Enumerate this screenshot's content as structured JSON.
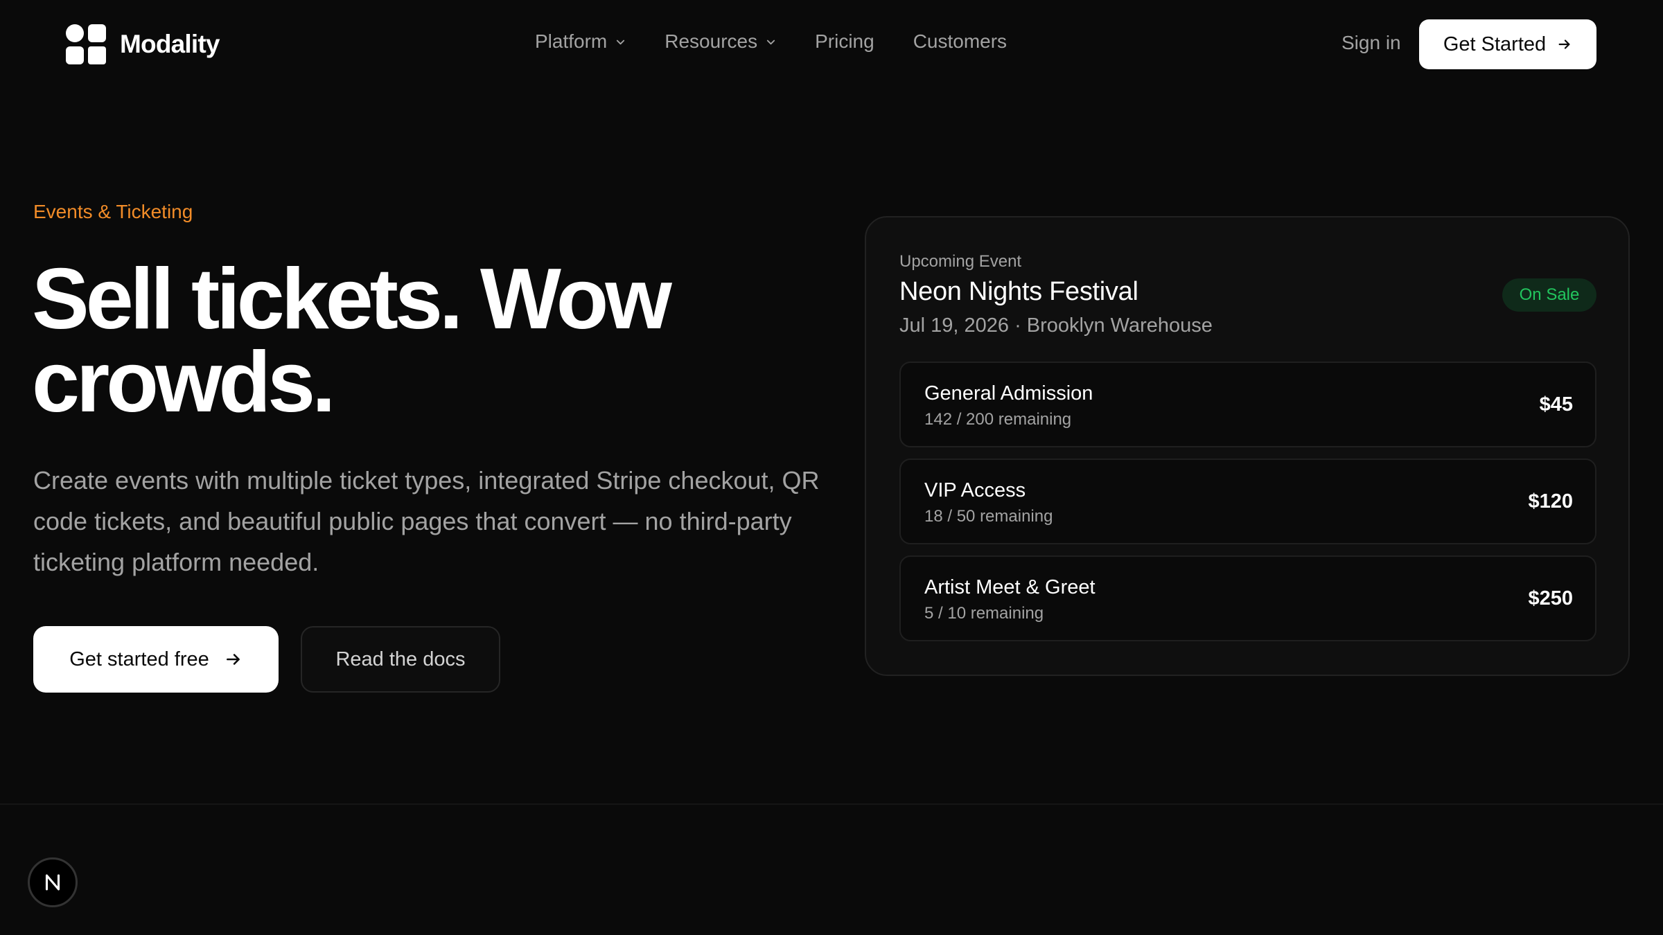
{
  "nav": {
    "brand": "Modality",
    "links": [
      {
        "label": "Platform",
        "has_dropdown": true
      },
      {
        "label": "Resources",
        "has_dropdown": true
      },
      {
        "label": "Pricing",
        "has_dropdown": false
      },
      {
        "label": "Customers",
        "has_dropdown": false
      }
    ],
    "sign_in": "Sign in",
    "cta": "Get Started"
  },
  "hero": {
    "eyebrow": "Events & Ticketing",
    "headline": "Sell tickets. Wow crowds.",
    "description": "Create events with multiple ticket types, integrated Stripe checkout, QR code tickets, and beautiful public pages that convert — no third-party ticketing platform needed.",
    "primary_cta": "Get started free",
    "secondary_cta": "Read the docs"
  },
  "event_card": {
    "eyebrow": "Upcoming Event",
    "title": "Neon Nights Festival",
    "subtitle": "Jul 19, 2026 · Brooklyn Warehouse",
    "status": "On Sale",
    "tiers": [
      {
        "name": "General Admission",
        "remaining": "142 / 200 remaining",
        "price": "$45"
      },
      {
        "name": "VIP Access",
        "remaining": "18 / 50 remaining",
        "price": "$120"
      },
      {
        "name": "Artist Meet & Greet",
        "remaining": "5 / 10 remaining",
        "price": "$250"
      }
    ]
  },
  "colors": {
    "background": "#0a0a0a",
    "accent_orange": "#f28c28",
    "status_green": "#22c55e",
    "muted_text": "#a3a3a3"
  },
  "icons": {
    "logo": "grid-logo-icon",
    "dropdown": "chevron-down-icon",
    "arrow": "arrow-right-icon",
    "dev_badge": "nextjs-n-icon"
  }
}
